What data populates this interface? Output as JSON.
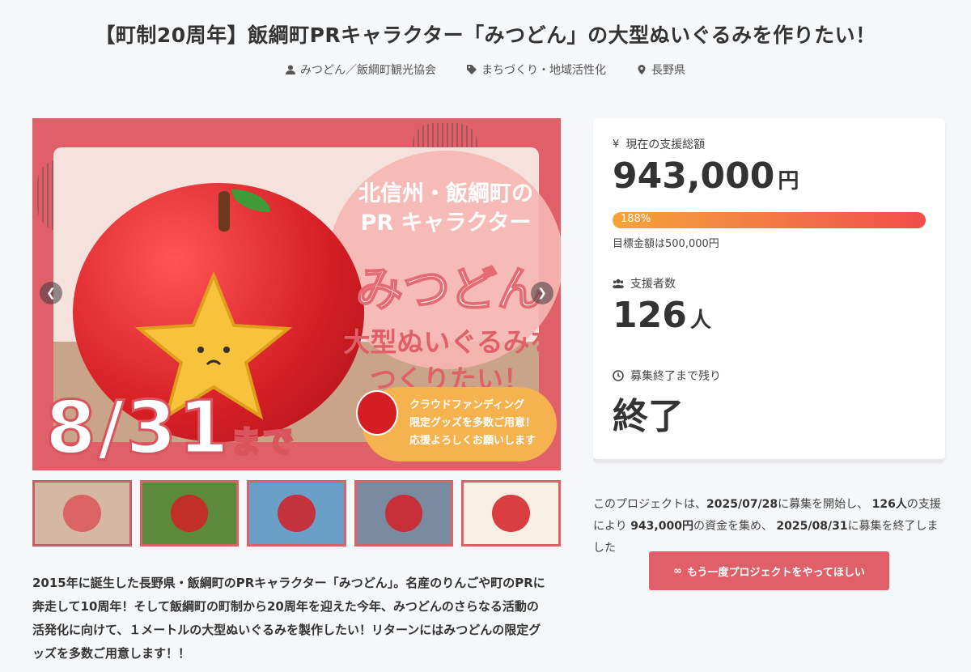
{
  "title": "【町制20周年】飯綱町PRキャラクター「みつどん」の大型ぬいぐるみを作りたい！",
  "meta": {
    "owner": "みつどん／飯綱町観光協会",
    "category": "まちづくり・地域活性化",
    "location": "長野県"
  },
  "hero": {
    "subtitle_line1": "北信州・飯綱町の",
    "subtitle_line2": "PR キャラクター",
    "character_name": "みつどん",
    "headline_line1": "大型ぬいぐるみを",
    "headline_line2": "つくりたい！",
    "date": "8/31",
    "date_suffix": "まで",
    "cf_line1": "クラウドファンディング",
    "cf_line2": "限定グッズを多数ご用意！",
    "cf_line3": "応援よろしくお願いします",
    "prev_icon": "chevron-left-icon",
    "next_icon": "chevron-right-icon"
  },
  "thumbnails": [
    {
      "theme": "#e0606a",
      "bg": "#c9a488"
    },
    {
      "theme": "#e0606a",
      "bg": "#5a8a3a"
    },
    {
      "theme": "#e0606a",
      "bg": "#6aa0c8"
    },
    {
      "theme": "#e0606a",
      "bg": "#7a8aa0"
    },
    {
      "theme": "#e0606a",
      "bg": "#f7efe2"
    }
  ],
  "description": "2015年に誕生した長野県・飯綱町のPRキャラクター「みつどん」。名産のりんごや町のPRに奔走して10周年！そして飯綱町の町制から20周年を迎えた今年、みつどんのさらなる活動の活発化に向けて、１メートルの大型ぬいぐるみを製作したい！リターンにはみつどんの限定グッズを多数ご用意します！！",
  "stats": {
    "funding_label": "現在の支援総額",
    "funding_value": "943,000",
    "funding_unit": "円",
    "progress_percent": 188,
    "progress_label": "188%",
    "goal_text": "目標金額は500,000円",
    "supporters_label": "支援者数",
    "supporters_value": "126",
    "supporters_unit": "人",
    "remaining_label": "募集終了まで残り",
    "remaining_value": "終了"
  },
  "summary": {
    "p1": "このプロジェクトは、",
    "start": "2025/07/28",
    "p2": "に募集を開始し、",
    "count": "126人",
    "p3": "の支援により",
    "amount": "943,000円",
    "p4": "の資金を集め、",
    "end": "2025/08/31",
    "p5": "に募集を終了しました"
  },
  "cta": {
    "label": "もう一度プロジェクトをやってほしい",
    "icon": "infinity-icon"
  },
  "colors": {
    "accent": "#e0606a",
    "progress_start": "#f6a43a",
    "progress_end": "#f24c4c"
  }
}
